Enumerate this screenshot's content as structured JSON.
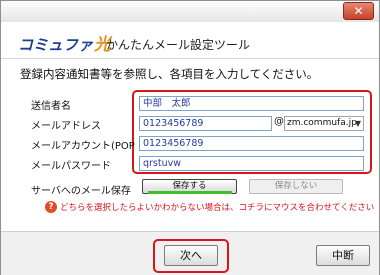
{
  "window": {
    "close_glyph": "✕"
  },
  "header": {
    "logo_text": "コミュファ",
    "logo_mark": "光",
    "title": "かんたんメール設定ツール"
  },
  "instruction": "登録内容通知書等を参照し、各項目を入力してください。",
  "form": {
    "sender_name": {
      "label": "送信者名",
      "value": "中部　太郎"
    },
    "email": {
      "label": "メールアドレス",
      "value": "0123456789",
      "at": "@",
      "domain": "zm.commufa.jp"
    },
    "account": {
      "label": "メールアカウント(POP ID)",
      "value": "0123456789"
    },
    "password": {
      "label": "メールパスワード",
      "value": "qrstuvw"
    }
  },
  "server_save": {
    "label": "サーバへのメール保存",
    "save_label": "保存する",
    "nosave_label": "保存しない"
  },
  "help": {
    "icon": "?",
    "text": "どちらを選択したらよいかわからない場合は、コチラにマウスを合わせてください"
  },
  "footer": {
    "next_label": "次へ",
    "stop_label": "中断"
  },
  "colors": {
    "accent": "#d9141b",
    "brand": "#1c3f94",
    "active_indicator": "#3fbf2e"
  }
}
